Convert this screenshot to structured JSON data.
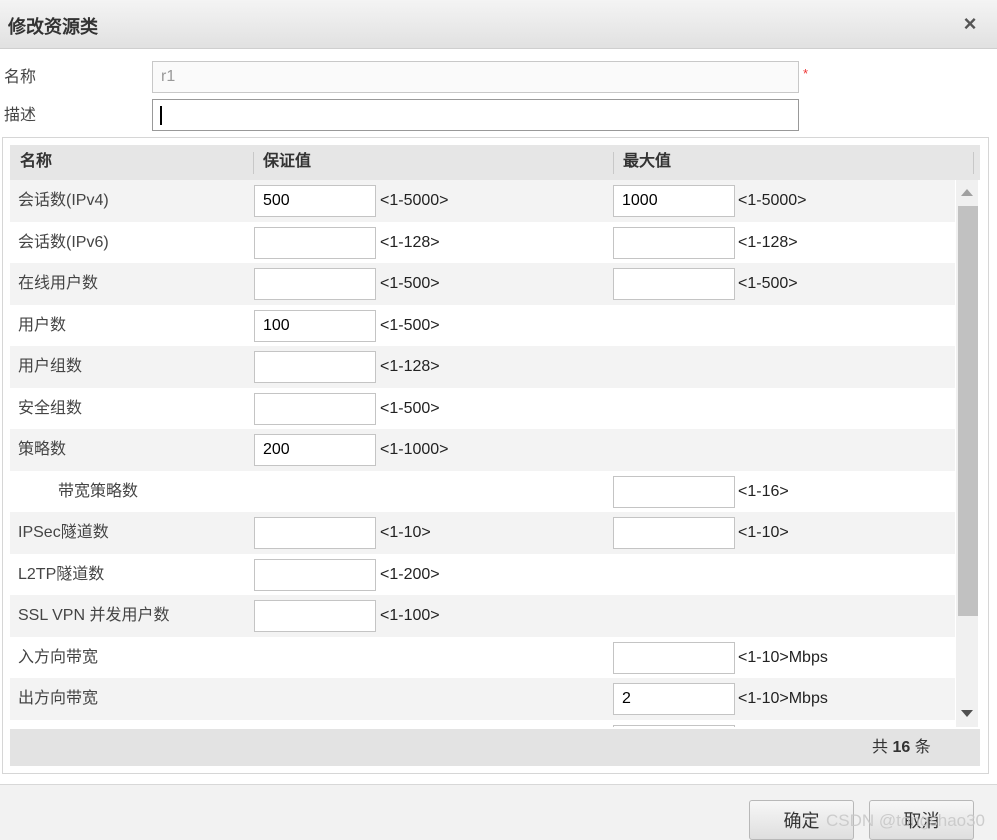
{
  "dialog": {
    "title": "修改资源类",
    "close_glyph": "×"
  },
  "form": {
    "name_label": "名称",
    "name_value": "r1",
    "required_mark": "*",
    "desc_label": "描述",
    "desc_value": ""
  },
  "grid": {
    "columns": [
      "名称",
      "保证值",
      "最大值"
    ],
    "rows": [
      {
        "name": "会话数(IPv4)",
        "guarantee": "500",
        "guarantee_range": "<1-5000>",
        "max": "1000",
        "max_range": "<1-5000>"
      },
      {
        "name": "会话数(IPv6)",
        "guarantee": "",
        "guarantee_range": "<1-128>",
        "max": "",
        "max_range": "<1-128>"
      },
      {
        "name": "在线用户数",
        "guarantee": "",
        "guarantee_range": "<1-500>",
        "max": "",
        "max_range": "<1-500>"
      },
      {
        "name": "用户数",
        "guarantee": "100",
        "guarantee_range": "<1-500>"
      },
      {
        "name": "用户组数",
        "guarantee": "",
        "guarantee_range": "<1-128>"
      },
      {
        "name": "安全组数",
        "guarantee": "",
        "guarantee_range": "<1-500>"
      },
      {
        "name": "策略数",
        "guarantee": "200",
        "guarantee_range": "<1-1000>"
      },
      {
        "name": "带宽策略数",
        "indent": true,
        "max": "",
        "max_range": "<1-16>"
      },
      {
        "name": "IPSec隧道数",
        "guarantee": "",
        "guarantee_range": "<1-10>",
        "max": "",
        "max_range": "<1-10>"
      },
      {
        "name": "L2TP隧道数",
        "guarantee": "",
        "guarantee_range": "<1-200>"
      },
      {
        "name": "SSL VPN 并发用户数",
        "guarantee": "",
        "guarantee_range": "<1-100>"
      },
      {
        "name": "入方向带宽",
        "max": "",
        "max_range": "<1-10>Mbps"
      },
      {
        "name": "出方向带宽",
        "max": "2",
        "max_range": "<1-10>Mbps"
      },
      {
        "name": "",
        "max": ""
      }
    ],
    "footer": {
      "prefix": "共",
      "count": "16",
      "suffix": "条"
    }
  },
  "buttons": {
    "ok": "确定",
    "cancel": "取消"
  },
  "watermark": "CSDN @tongshao30"
}
